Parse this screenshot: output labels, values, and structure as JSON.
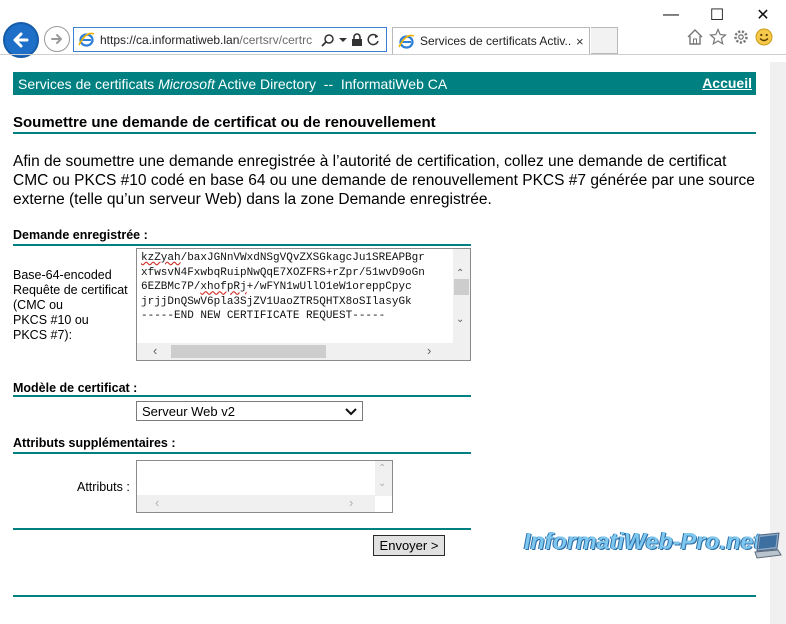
{
  "browser": {
    "url_host": "https://ca.informatiweb.lan",
    "url_path": "/certsrv/certrc",
    "tab_title": "Services de certificats Activ...",
    "tab_close": "×",
    "window_controls": {
      "minimize": "—",
      "maximize": "☐",
      "close": "✕"
    }
  },
  "page": {
    "header_prefix": "Services de certificats ",
    "header_brand": "Microsoft",
    "header_suffix": " Active Directory  --  InformatiWeb CA",
    "home_link": "Accueil",
    "title": "Soumettre une demande de certificat ou de renouvellement",
    "intro": "Afin de soumettre une demande enregistrée à l’autorité de certification, collez une demande de certificat CMC ou PKCS #10 codé en base 64 ou une demande de renouvellement PKCS #7 générée par une source externe (telle qu’un serveur Web) dans la zone Demande enregistrée.",
    "saved_request": {
      "section_label": "Demande enregistrée :",
      "field_label_lines": [
        "Base-64-encoded",
        "Requête de certificat",
        "(CMC ou",
        "PKCS #10 ou",
        "PKCS #7):"
      ],
      "text_lines": [
        {
          "spell": "kzZyah",
          "rest": "/baxJGNnVWxdNSgVQvZXSGkagcJu1SREAPBgr"
        },
        {
          "spell": "",
          "rest": "xfwsvN4FxwbqRuipNwQqE7XOZFRS+rZpr/51wvD9oGn"
        },
        {
          "pre": "6EZBMc7P/",
          "spell": "xhofpRj",
          "rest": "+/wFYN1wUllO1eW1oreppCpyc"
        },
        {
          "spell": "",
          "rest": "jrjjDnQSwV6pla3SjZV1UaoZTR5QHTX8oSIlasyGk"
        },
        {
          "spell": "",
          "rest": "-----END NEW CERTIFICATE REQUEST-----"
        }
      ]
    },
    "template": {
      "section_label": "Modèle de certificat :",
      "selected": "Serveur Web v2"
    },
    "attributes": {
      "section_label": "Attributs supplémentaires :",
      "field_label": "Attributs :"
    },
    "submit_label": "Envoyer >"
  },
  "watermark": "InformatiWeb-Pro.net",
  "colors": {
    "accent": "#008080",
    "browser_blue": "#1e6fc8",
    "watermark": "#7ec8f0"
  },
  "icons": {
    "back": "back-arrow-icon",
    "forward": "forward-arrow-icon",
    "search": "search-icon",
    "lock": "lock-icon",
    "refresh": "refresh-icon",
    "home": "home-icon",
    "favorites": "star-icon",
    "settings": "gear-icon",
    "feedback": "smiley-icon"
  }
}
